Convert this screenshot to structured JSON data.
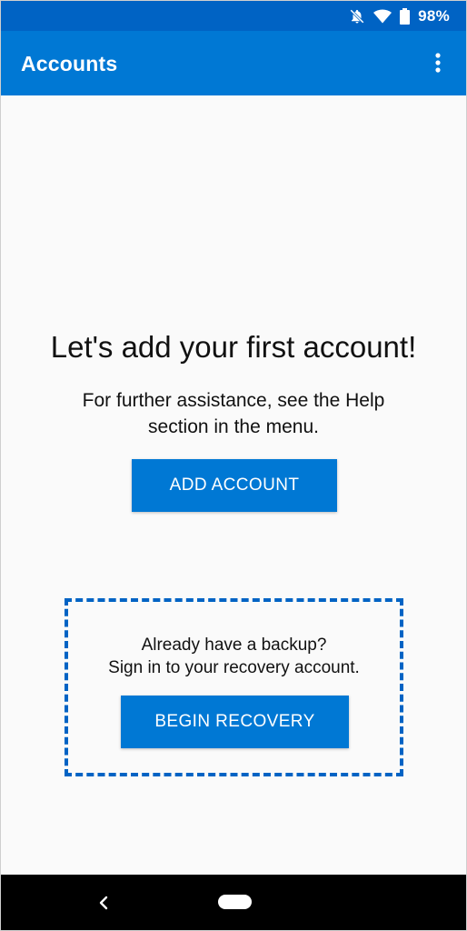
{
  "status_bar": {
    "battery_percent": "98%",
    "icons": [
      "notifications-off-icon",
      "wifi-icon",
      "battery-icon"
    ],
    "color": "#0063c4"
  },
  "app_bar": {
    "title": "Accounts",
    "menu_icon": "more-vert-icon",
    "color": "#0078d4"
  },
  "main": {
    "headline": "Let's add your first account!",
    "subtext_line1": "For further assistance, see the Help",
    "subtext_line2": "section in the menu.",
    "add_account_label": "ADD ACCOUNT"
  },
  "recovery": {
    "line1": "Already have a backup?",
    "line2": "Sign in to your recovery account.",
    "button_label": "BEGIN RECOVERY"
  },
  "nav_bar": {
    "back_icon": "back-chevron-icon",
    "home_icon": "home-pill-icon"
  }
}
